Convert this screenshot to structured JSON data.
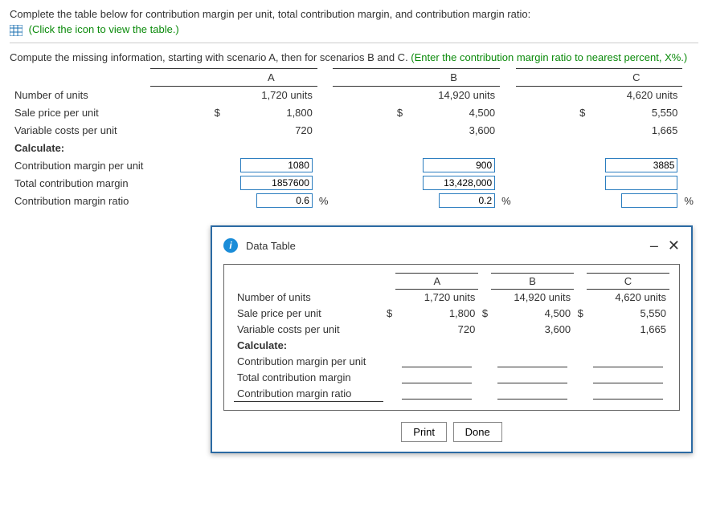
{
  "header": {
    "line1": "Complete the table below for contribution margin per unit, total contribution margin, and contribution margin ratio:",
    "link_text": "(Click the icon to view the table.)",
    "line2_a": "Compute the missing information, starting with scenario A, then for scenarios B and C. ",
    "line2_b": "(Enter the contribution margin ratio to nearest percent, X%.)"
  },
  "cols": {
    "a": "A",
    "b": "B",
    "c": "C"
  },
  "rows": {
    "num_units": "Number of units",
    "sale_price": "Sale price per unit",
    "var_cost": "Variable costs per unit",
    "calculate": "Calculate:",
    "cm_unit": "Contribution margin per unit",
    "total_cm": "Total contribution margin",
    "cm_ratio": "Contribution margin ratio"
  },
  "currency": "$",
  "suffix_units": "units",
  "suffix_pct": "%",
  "given": {
    "a": {
      "units": "1,720",
      "price": "1,800",
      "varc": "720"
    },
    "b": {
      "units": "14,920",
      "price": "4,500",
      "varc": "3,600"
    },
    "c": {
      "units": "4,620",
      "price": "5,550",
      "varc": "1,665"
    }
  },
  "inputs": {
    "cm_unit": {
      "a": "1080",
      "b": "900",
      "c": "3885"
    },
    "total_cm": {
      "a": "1857600",
      "b": "13,428,000",
      "c": ""
    },
    "cm_ratio": {
      "a": "0.6",
      "b": "0.2",
      "c": ""
    }
  },
  "popup": {
    "title": "Data Table",
    "print": "Print",
    "done": "Done"
  },
  "chart_data": {
    "type": "table",
    "title": "Contribution margin worksheet",
    "columns": [
      "A",
      "B",
      "C"
    ],
    "rows": [
      {
        "label": "Number of units",
        "unit": "units",
        "values": [
          1720,
          14920,
          4620
        ]
      },
      {
        "label": "Sale price per unit",
        "unit": "$",
        "values": [
          1800,
          4500,
          5550
        ]
      },
      {
        "label": "Variable costs per unit",
        "unit": "$",
        "values": [
          720,
          3600,
          1665
        ]
      },
      {
        "label": "Contribution margin per unit",
        "unit": "$",
        "values": [
          1080,
          900,
          3885
        ]
      },
      {
        "label": "Total contribution margin",
        "unit": "$",
        "values": [
          1857600,
          13428000,
          null
        ]
      },
      {
        "label": "Contribution margin ratio",
        "unit": "%",
        "values": [
          0.6,
          0.2,
          null
        ]
      }
    ]
  }
}
